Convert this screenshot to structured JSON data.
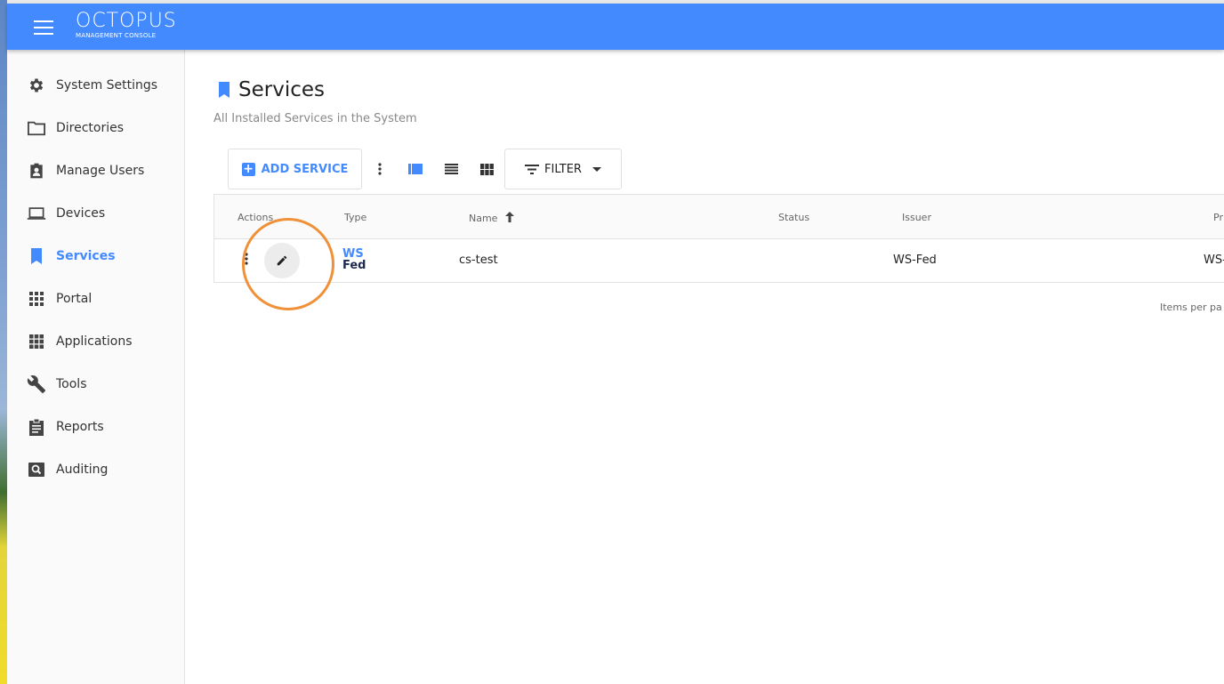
{
  "app": {
    "logo_main": "OCTOPUS",
    "logo_sub": "MANAGEMENT CONSOLE",
    "accent": "#448aff"
  },
  "sidebar": {
    "items": [
      {
        "label": "System Settings",
        "icon": "gear-icon",
        "active": false
      },
      {
        "label": "Directories",
        "icon": "folder-icon",
        "active": false
      },
      {
        "label": "Manage Users",
        "icon": "user-badge-icon",
        "active": false
      },
      {
        "label": "Devices",
        "icon": "laptop-icon",
        "active": false
      },
      {
        "label": "Services",
        "icon": "bookmark-icon",
        "active": true
      },
      {
        "label": "Portal",
        "icon": "grid-dots-icon",
        "active": false
      },
      {
        "label": "Applications",
        "icon": "grid-squares-icon",
        "active": false
      },
      {
        "label": "Tools",
        "icon": "wrench-icon",
        "active": false
      },
      {
        "label": "Reports",
        "icon": "clipboard-icon",
        "active": false
      },
      {
        "label": "Auditing",
        "icon": "search-box-icon",
        "active": false
      }
    ]
  },
  "page": {
    "title": "Services",
    "subtitle": "All Installed Services in the System"
  },
  "toolbar": {
    "add_label": "ADD SERVICE",
    "filter_label": "FILTER"
  },
  "table": {
    "headers": {
      "actions": "Actions",
      "type": "Type",
      "name": "Name",
      "status": "Status",
      "issuer": "Issuer",
      "pr": "Pr"
    },
    "rows": [
      {
        "type_logo_top": "WS",
        "type_logo_bottom": "Fed",
        "name": "cs-test",
        "status": "",
        "issuer": "WS-Fed",
        "pr": "WS-"
      }
    ]
  },
  "pagination": {
    "items_per_page": "Items per pa"
  }
}
